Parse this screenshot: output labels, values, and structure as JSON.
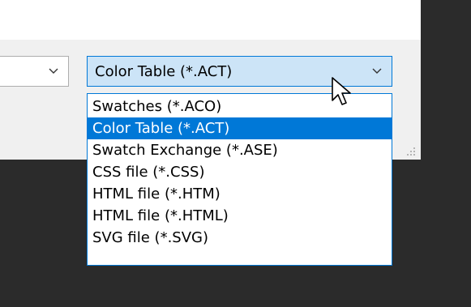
{
  "left_combo": {
    "value": "",
    "arrow_icon": "chevron-down-icon"
  },
  "format_combo": {
    "value": "Color Table (*.ACT)",
    "arrow_icon": "chevron-down-icon"
  },
  "dropdown": {
    "selected_index": 1,
    "options": [
      "Swatches (*.ACO)",
      "Color Table (*.ACT)",
      "Swatch Exchange (*.ASE)",
      "CSS file (*.CSS)",
      "HTML file (*.HTM)",
      "HTML file (*.HTML)",
      "SVG file (*.SVG)"
    ]
  },
  "colors": {
    "accent": "#0078d7",
    "combo_focus_bg": "#cce4f7",
    "dialog_bg": "#f0f0f0",
    "backdrop": "#2b2b2b"
  },
  "icons": {
    "cursor": "mouse-pointer-icon",
    "grip": "resize-grip-icon"
  }
}
